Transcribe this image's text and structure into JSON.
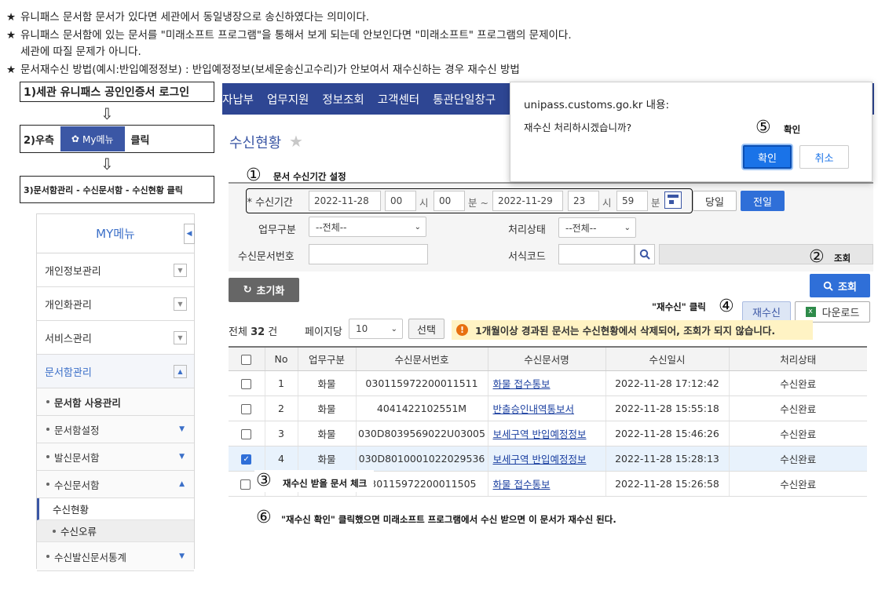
{
  "notes": [
    "유니패스 문서함 문서가 있다면 세관에서 동일냉장으로 송신하였다는 의미이다.",
    "유니패스 문서함에 있는 문서를 \"미래소프트 프로그램\"을 통해서 보게 되는데 안보인다면 \"미래소프트\" 프로그램의 문제이다.",
    "세관에 따질 문제가 아니다.",
    "문서재수신 방법(예시:반입예정정보) : 반입예정정보(보세운송신고수리)가 안보여서 재수신하는 경우 재수신 방법"
  ],
  "star_glyph": "★",
  "steps": {
    "step1": "1)세관 유니패스 공인인증서 로그인",
    "step2_prefix": "2)우측",
    "step2_button": "My메뉴",
    "step2_suffix": "클릭",
    "step3": "3)문서함관리 - 수신문서함 - 수신현황 클릭",
    "arrow": "⇩"
  },
  "sidebar": {
    "title": "MY메뉴",
    "items": [
      "개인정보관리",
      "개인화관리",
      "서비스관리"
    ],
    "active_item": "문서함관리",
    "subitems": [
      {
        "label": "문서함 사용관리",
        "expanded": false
      },
      {
        "label": "문서함설정",
        "expanded": false
      },
      {
        "label": "발신문서함",
        "expanded": false
      },
      {
        "label": "수신문서함",
        "expanded": true
      }
    ],
    "leaves": [
      "수신현황",
      "수신오류"
    ],
    "last_sub": "수신발신문서통계"
  },
  "topnav": {
    "items": [
      "자납부",
      "업무지원",
      "정보조회",
      "고객센터",
      "통관단일창구"
    ]
  },
  "page": {
    "title": "수신현황"
  },
  "search": {
    "period_label": "* 수신기간",
    "date_from": "2022-11-28",
    "hour_from": "00",
    "min_from": "00",
    "date_to": "2022-11-29",
    "hour_to": "23",
    "min_to": "59",
    "hour_unit": "시",
    "min_unit": "분",
    "min_unit_tilde": "분 ~",
    "today_btn": "당일",
    "prevday_btn": "전일",
    "biz_label": "업무구분",
    "biz_value": "--전체--",
    "status_label": "처리상태",
    "status_value": "--전체--",
    "docno_label": "수신문서번호",
    "docno_value": "",
    "form_label": "서식코드",
    "form_value": ""
  },
  "buttons": {
    "reset": "초기화",
    "search": "조회",
    "resend": "재수신",
    "download": "다운로드",
    "select": "선택"
  },
  "list": {
    "total_prefix": "전체",
    "total_count": "32",
    "total_suffix": "건",
    "per_page_label": "페이지당",
    "per_page_value": "10",
    "warning": "1개월이상 경과된 문서는 수신현황에서 삭제되어, 조회가 되지 않습니다."
  },
  "table": {
    "headers": [
      "No",
      "업무구분",
      "수신문서번호",
      "수신문서명",
      "수신일시",
      "처리상태"
    ],
    "rows": [
      {
        "checked": false,
        "no": "1",
        "biz": "화물",
        "docno": "030115972200011511",
        "name": "화물 접수통보",
        "date": "2022-11-28 17:12:42",
        "status": "수신완료"
      },
      {
        "checked": false,
        "no": "2",
        "biz": "화물",
        "docno": "4041422102551M",
        "name": "반출승인내역통보서",
        "date": "2022-11-28 15:55:18",
        "status": "수신완료"
      },
      {
        "checked": false,
        "no": "3",
        "biz": "화물",
        "docno": "030D8039569022U03005",
        "name": "보세구역 반입예정정보",
        "date": "2022-11-28 15:46:26",
        "status": "수신완료"
      },
      {
        "checked": true,
        "no": "4",
        "biz": "화물",
        "docno": "030D8010001022029536",
        "name": "보세구역 반입예정정보",
        "date": "2022-11-28 15:28:13",
        "status": "수신완료"
      },
      {
        "checked": false,
        "no": "5",
        "biz": "화물",
        "docno": "030115972200011505",
        "name": "화물 접수통보",
        "date": "2022-11-28 15:26:58",
        "status": "수신완료"
      }
    ]
  },
  "dialog": {
    "title": "unipass.customs.go.kr 내용:",
    "message": "재수신 처리하시겠습니까?",
    "ok": "확인",
    "cancel": "취소"
  },
  "annotations": {
    "n1": "①",
    "t1": "문서 수신기간 설정",
    "n2": "②",
    "t2": "조회",
    "n3": "③",
    "t3": "재수신 받을 문서 체크",
    "n4": "④",
    "t4": "\"재수신\" 클릭",
    "n5": "⑤",
    "t5": "확인",
    "n6": "⑥",
    "t6": "\"재수신 확인\" 클릭했으면 미래소프트 프로그램에서 수신 받으면 이 문서가 재수신 된다."
  },
  "colors": {
    "nav": "#2e4693",
    "accent": "#3b57a5",
    "primary_button": "#2f6fd8",
    "warning": "#fff3c4"
  }
}
